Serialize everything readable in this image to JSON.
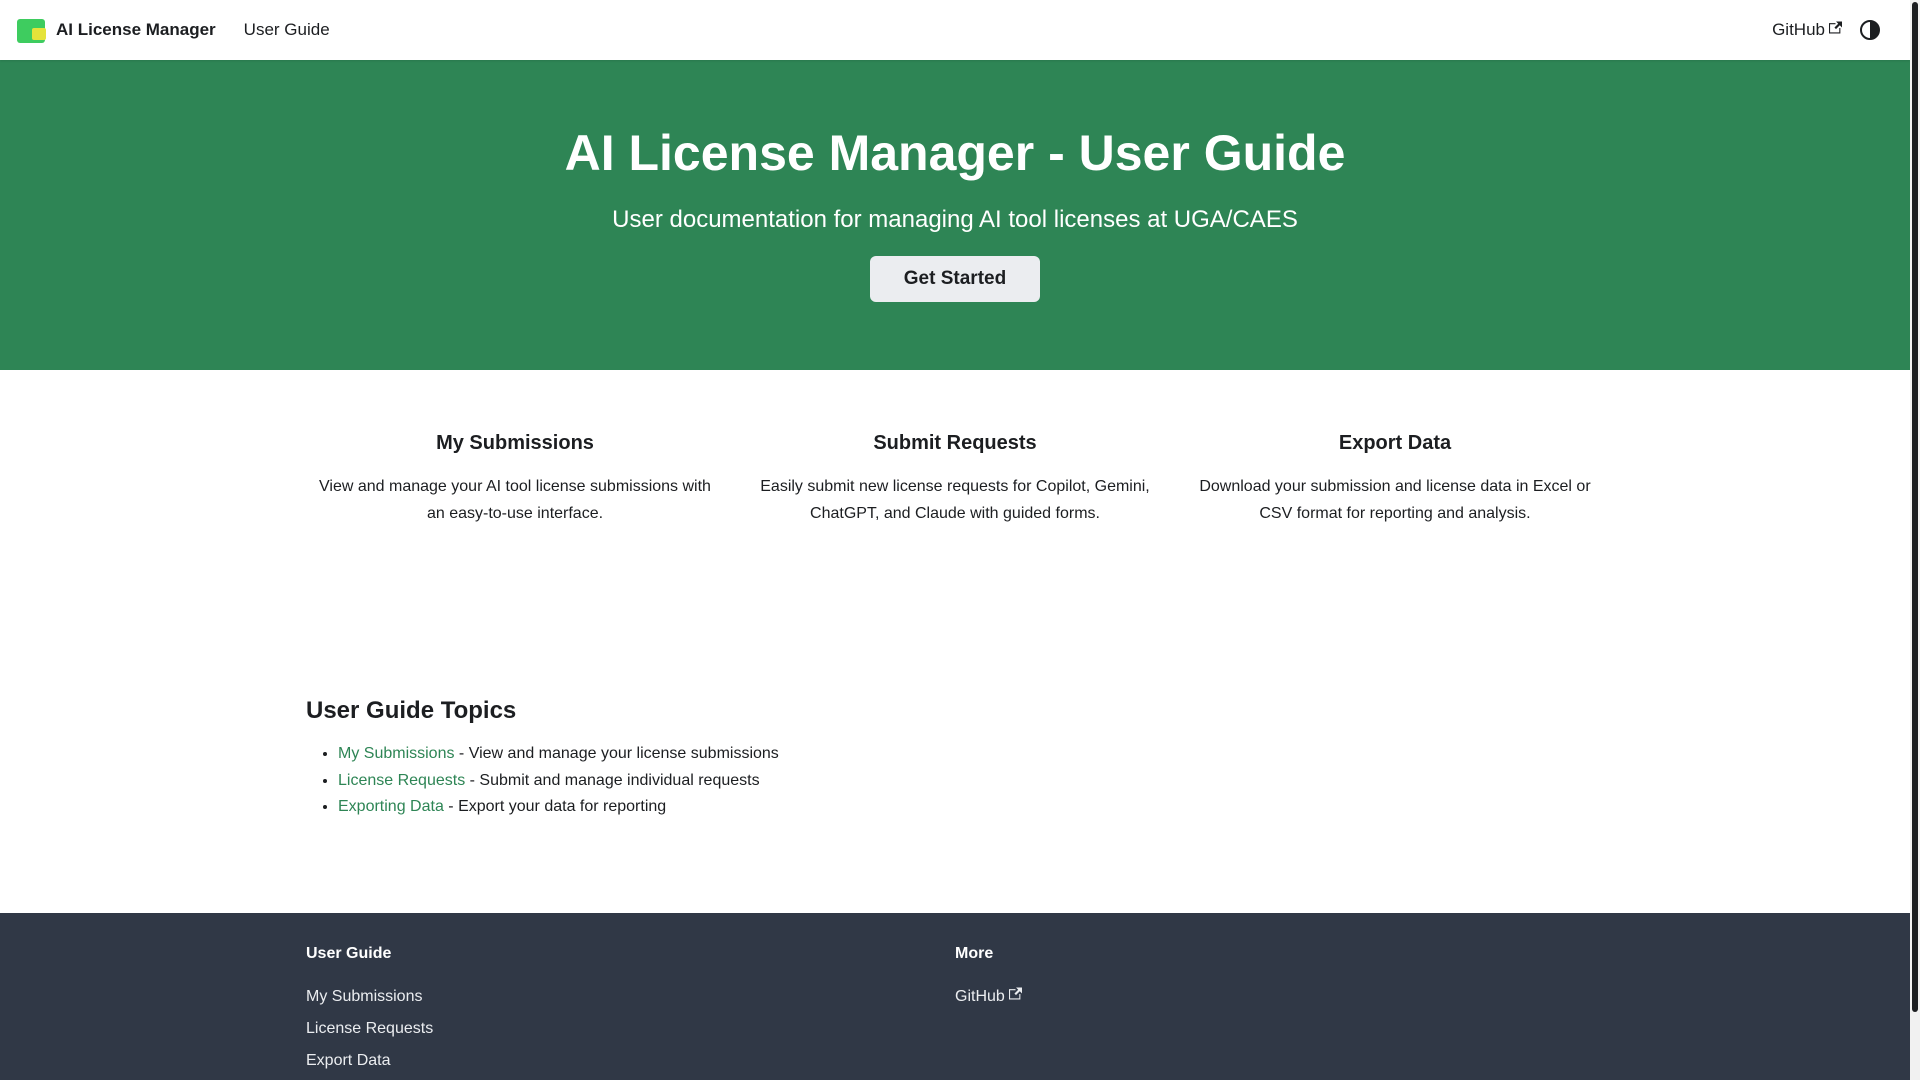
{
  "navbar": {
    "brand": "AI License Manager",
    "user_guide": "User Guide",
    "github": "GitHub"
  },
  "hero": {
    "title": "AI License Manager - User Guide",
    "subtitle": "User documentation for managing AI tool licenses at UGA/CAES",
    "cta": "Get Started"
  },
  "features": [
    {
      "title": "My Submissions",
      "text": "View and manage your AI tool license submissions with an easy-to-use interface."
    },
    {
      "title": "Submit Requests",
      "text": "Easily submit new license requests for Copilot, Gemini, ChatGPT, and Claude with guided forms."
    },
    {
      "title": "Export Data",
      "text": "Download your submission and license data in Excel or CSV format for reporting and analysis."
    }
  ],
  "topics": {
    "heading": "User Guide Topics",
    "items": [
      {
        "link": "My Submissions",
        "desc": " - View and manage your license submissions"
      },
      {
        "link": "License Requests",
        "desc": " - Submit and manage individual requests"
      },
      {
        "link": "Exporting Data",
        "desc": " - Export your data for reporting"
      }
    ]
  },
  "footer": {
    "col1": {
      "title": "User Guide",
      "links": [
        "My Submissions",
        "License Requests",
        "Export Data"
      ]
    },
    "col2": {
      "title": "More",
      "links": [
        "GitHub"
      ]
    }
  },
  "colors": {
    "primary": "#2e8555",
    "footer": "#303846"
  }
}
